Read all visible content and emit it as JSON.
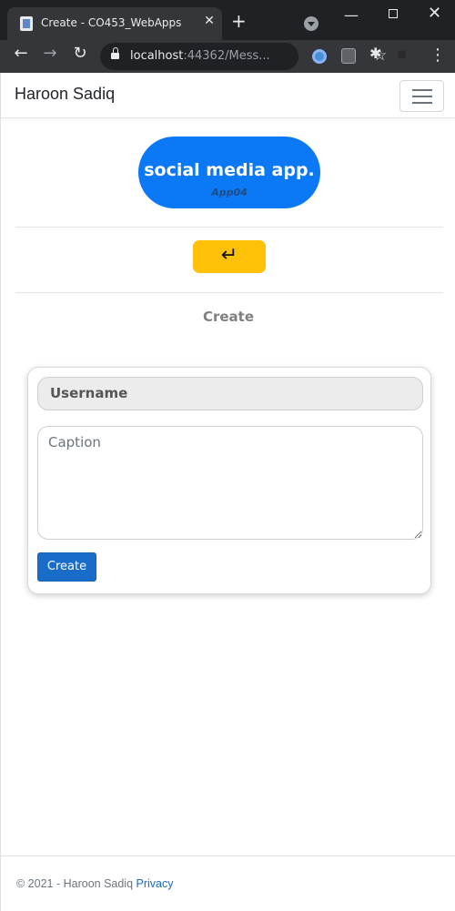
{
  "browser": {
    "tab_title": "Create - CO453_WebApps",
    "tab_close": "✕",
    "new_tab": "+",
    "url_host": "localhost",
    "url_rest": ":44362/Mess...",
    "icons": {
      "back": "←",
      "forward": "→",
      "reload": "↻",
      "star": "☆",
      "puzzle": "✱",
      "menu": "⋮",
      "minimize": "—",
      "close": "✕"
    }
  },
  "navbar": {
    "brand": "Haroon Sadiq"
  },
  "logo": {
    "title": "social media app.",
    "subtitle": "App04",
    "color": "#0b78f5"
  },
  "back_button": {
    "icon": "↵",
    "color": "#ffc107"
  },
  "page": {
    "title": "Create"
  },
  "form": {
    "username_value": "Username",
    "caption_placeholder": "Caption",
    "submit_label": "Create",
    "submit_color": "#1a6cc9"
  },
  "footer": {
    "text": "© 2021 - Haroon Sadiq ",
    "link": "Privacy"
  }
}
